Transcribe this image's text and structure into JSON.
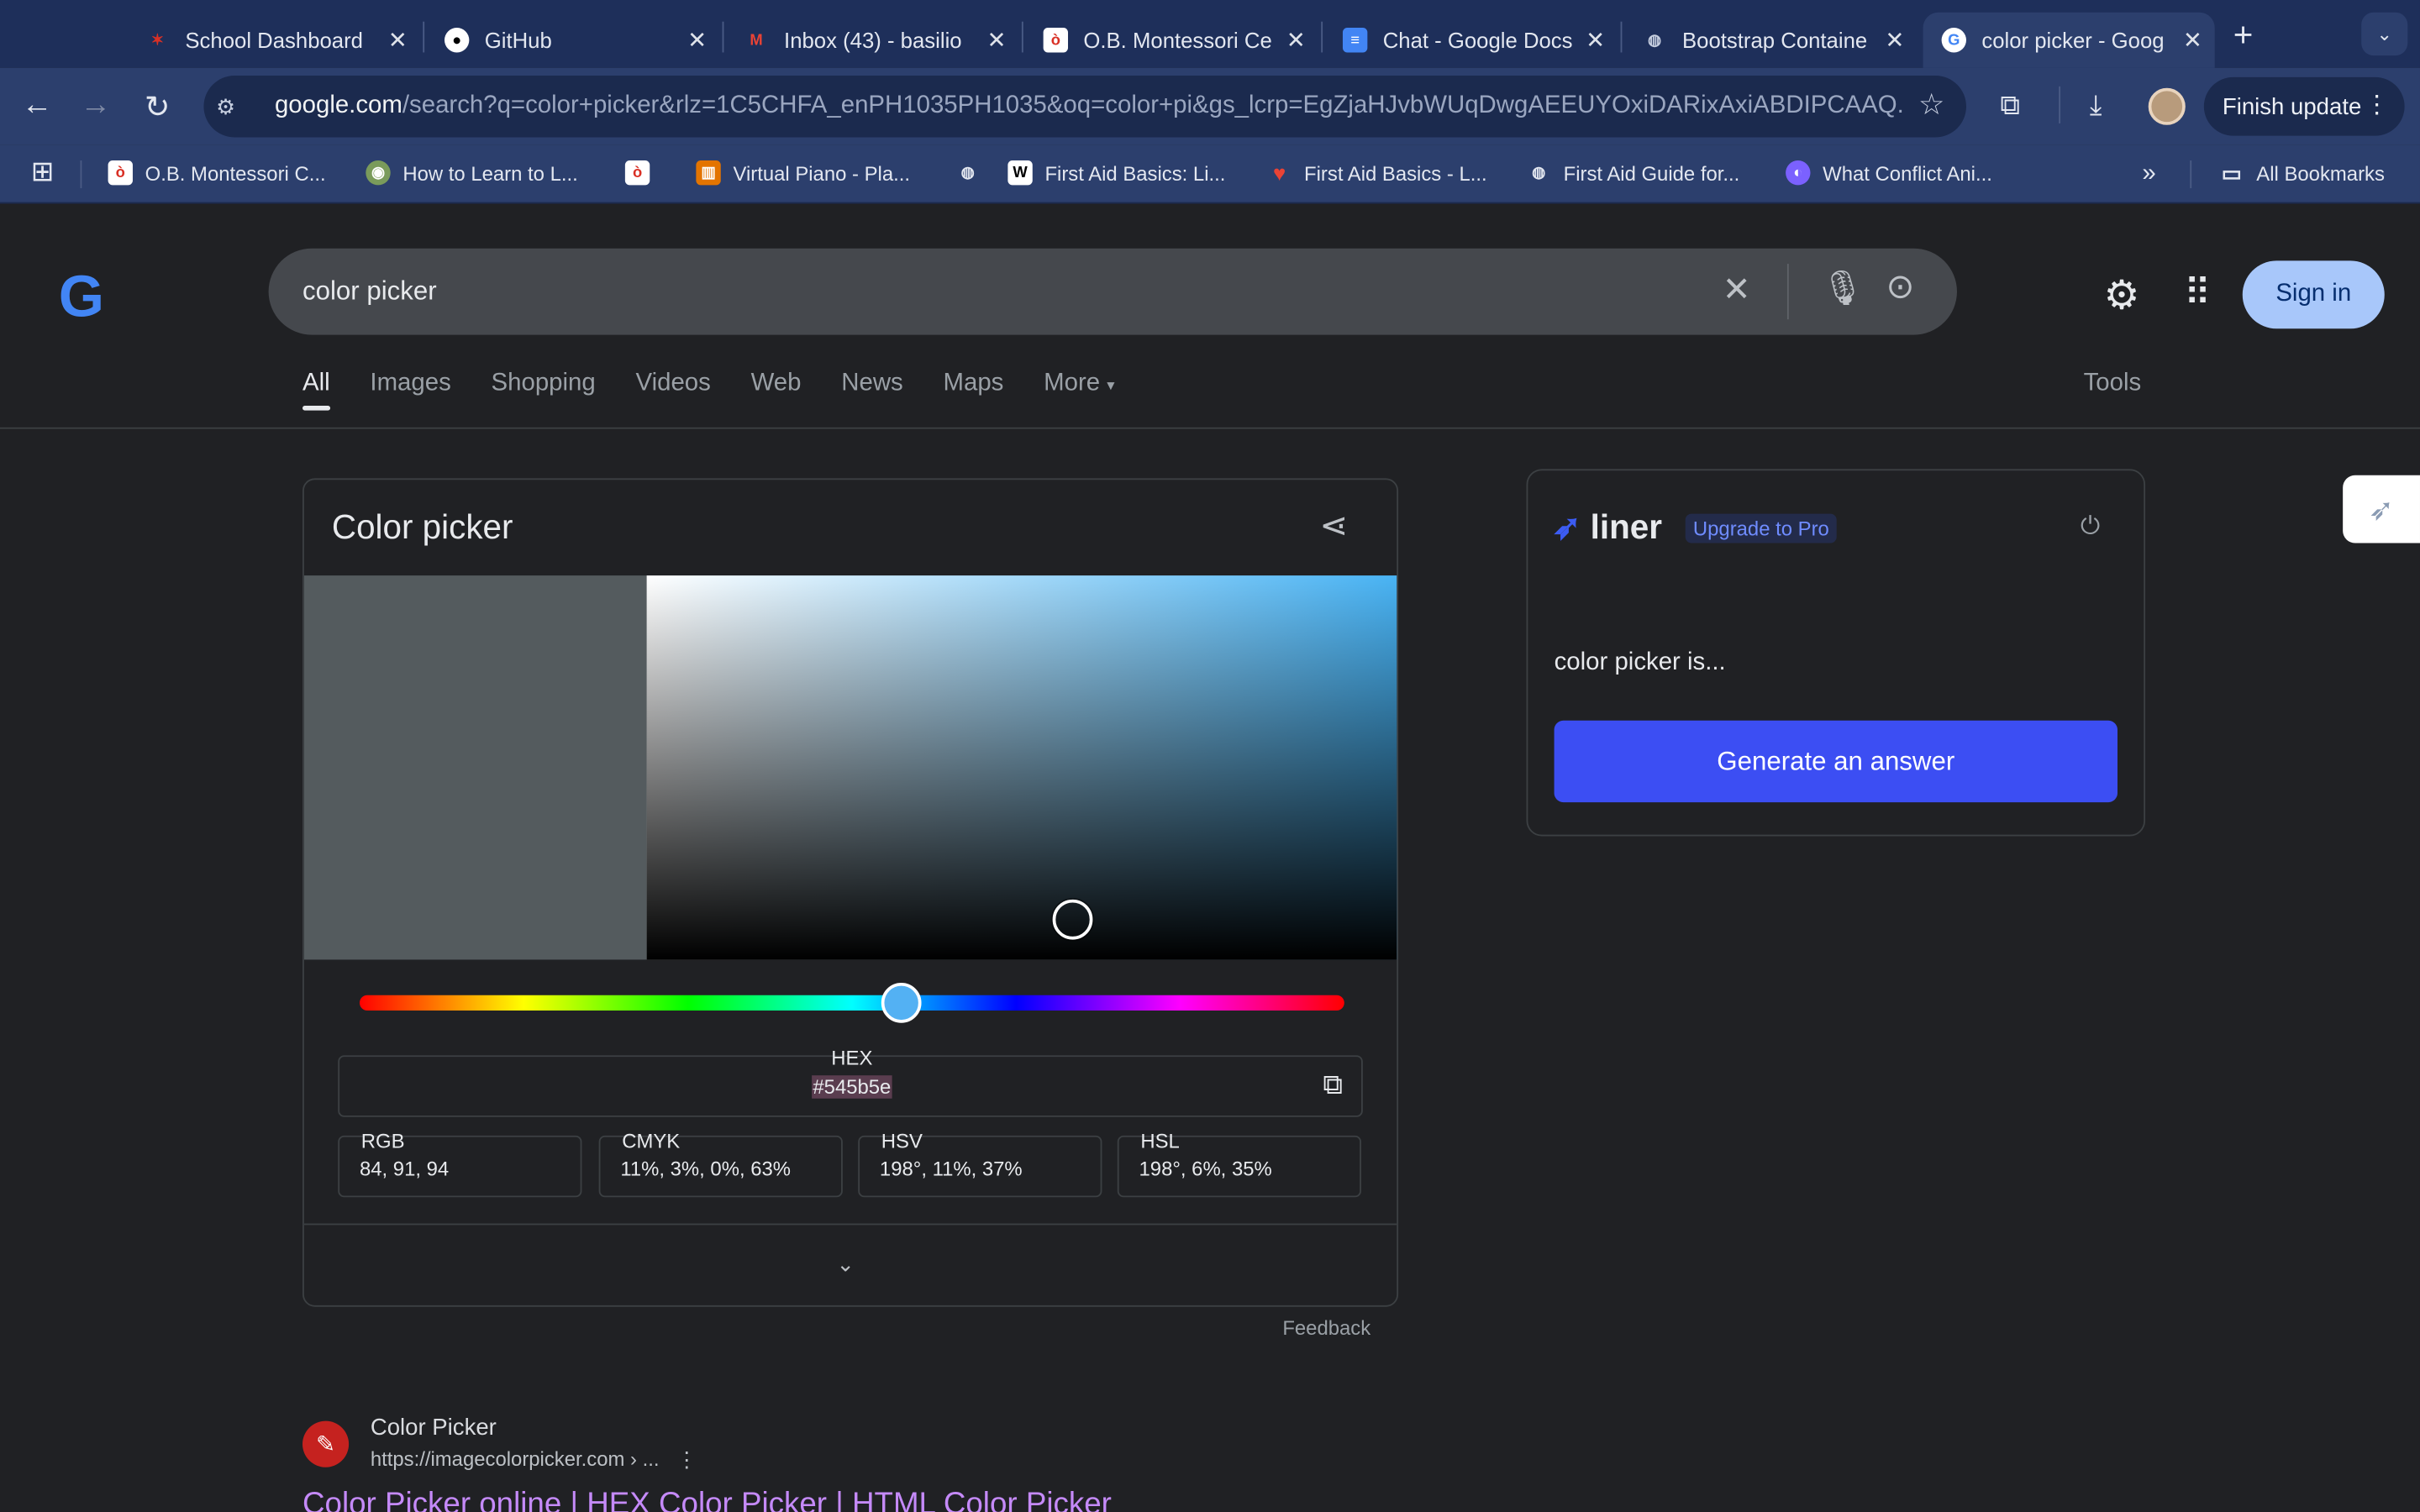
{
  "browser": {
    "tabs": [
      {
        "title": "School Dashboard",
        "icon": "school-dashboard-favicon",
        "color": "#d93025"
      },
      {
        "title": "GitHub",
        "icon": "github-favicon",
        "color": "#ffffff"
      },
      {
        "title": "Inbox (43) - basilio",
        "icon": "gmail-favicon",
        "color": "#ea4335"
      },
      {
        "title": "O.B. Montessori Ce",
        "icon": "obm-favicon",
        "color": "#d93025"
      },
      {
        "title": "Chat - Google Docs",
        "icon": "google-docs-favicon",
        "color": "#4285f4"
      },
      {
        "title": "Bootstrap Containe",
        "icon": "globe-favicon",
        "color": "#c7cfe0"
      },
      {
        "title": "color picker - Goog",
        "icon": "google-favicon",
        "color": "#ffffff",
        "active": true
      }
    ],
    "url_host": "google.com",
    "url_rest": "/search?q=color+picker&rlz=1C5CHFA_enPH1035PH1035&oq=color+pi&gs_lcrp=EgZjaHJvbWUqDwgAEEUYOxiDARixAxiABDIPCAAQ...",
    "finish_update": "Finish update",
    "bookmarks": [
      {
        "label": "O.B. Montessori C...",
        "icon": "obm-favicon"
      },
      {
        "label": "How to Learn to L...",
        "icon": "learn-favicon"
      },
      {
        "label": "",
        "icon": "obm-favicon"
      },
      {
        "label": "Virtual Piano - Pla...",
        "icon": "piano-favicon"
      },
      {
        "label": "",
        "icon": "globe-favicon"
      },
      {
        "label": "First Aid Basics: Li...",
        "icon": "w-favicon"
      },
      {
        "label": "First Aid Basics - L...",
        "icon": "heart-favicon"
      },
      {
        "label": "First Aid Guide for...",
        "icon": "globe-favicon"
      },
      {
        "label": "What Conflict Ani...",
        "icon": "purple-favicon"
      }
    ],
    "all_bookmarks": "All Bookmarks"
  },
  "google": {
    "logo": "G",
    "query": "color picker",
    "sign_in": "Sign in",
    "tabs": [
      "All",
      "Images",
      "Shopping",
      "Videos",
      "Web",
      "News",
      "Maps",
      "More"
    ],
    "tools": "Tools"
  },
  "color_picker": {
    "title": "Color picker",
    "swatch_color": "#545b5e",
    "hue_fraction": 0.55,
    "hex_label": "HEX",
    "hex_value": "#545b5e",
    "fields": [
      {
        "label": "RGB",
        "value": "84, 91, 94"
      },
      {
        "label": "CMYK",
        "value": "11%, 3%, 0%, 63%"
      },
      {
        "label": "HSV",
        "value": "198°, 11%, 37%"
      },
      {
        "label": "HSL",
        "value": "198°, 6%, 35%"
      }
    ],
    "feedback": "Feedback"
  },
  "result": {
    "site": "Color Picker",
    "url": "https://imagecolorpicker.com › ...",
    "title": "Color Picker online | HEX Color Picker | HTML Color Picker"
  },
  "liner": {
    "brand": "liner",
    "upgrade": "Upgrade to Pro",
    "question": "color picker is...",
    "button": "Generate an answer",
    "accent": "#3c4ef3"
  }
}
